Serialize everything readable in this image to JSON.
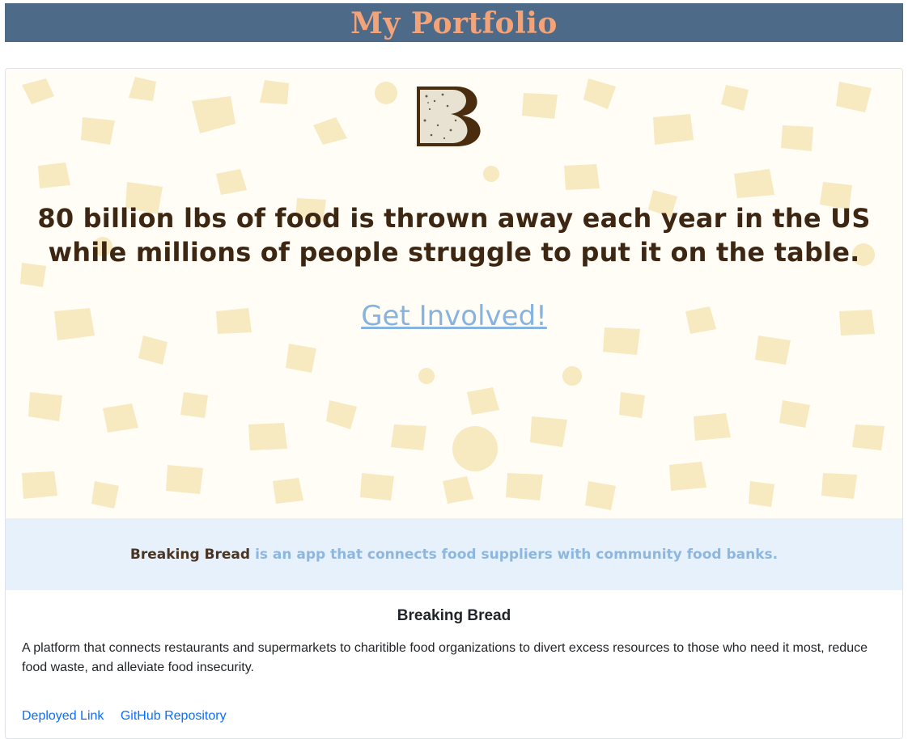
{
  "header": {
    "title": "My Portfolio",
    "background_color": "#4d6a88",
    "title_color": "#f4a277"
  },
  "project": {
    "preview": {
      "logo_icon": "breaking-bread-b-logo",
      "headline_line1": "80 billion lbs of food is thrown away each year in the US",
      "headline_line2": "while millions of people struggle to put it on the table.",
      "cta_link": "Get Involved!",
      "pattern_color": "#f7e9c0",
      "accent_color": "#86b3e0",
      "brand_brown": "#3d2712"
    },
    "tagline": {
      "brand": "Breaking Bread",
      "text": "is an app that connects food suppliers with community food banks."
    },
    "title": "Breaking Bread",
    "description": "A platform that connects restaurants and supermarkets to charitible food organizations to divert excess resources to those who need it most, reduce food waste, and alleviate food insecurity.",
    "links": {
      "deployed": "Deployed Link",
      "github": "GitHub Repository"
    }
  }
}
